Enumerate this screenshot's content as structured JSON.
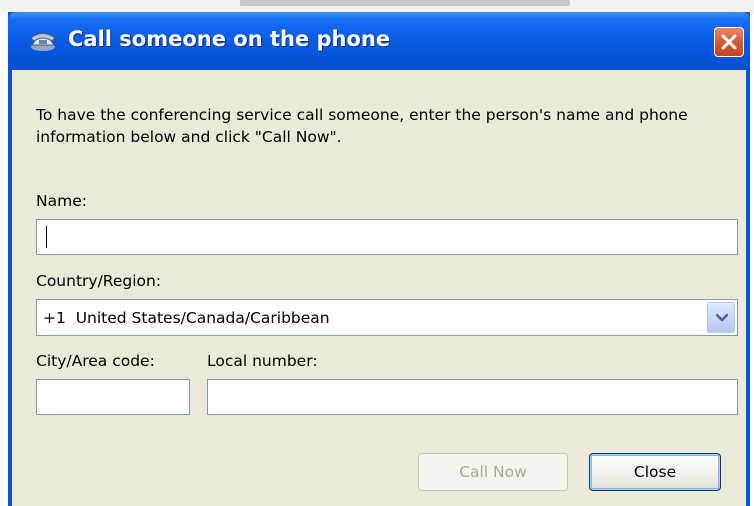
{
  "dialog": {
    "title": "Call someone on the phone",
    "close_icon": "close-icon",
    "title_icon": "phone-icon"
  },
  "instructions": "To have the conferencing service call someone, enter the person's name and phone information below and click \"Call Now\".",
  "fields": {
    "name_label": "Name:",
    "name_value": "",
    "country_label": "Country/Region:",
    "country_value": "+1  United States/Canada/Caribbean",
    "country_dropdown_icon": "chevron-down-icon",
    "area_code_label": "City/Area code:",
    "area_code_value": "",
    "local_number_label": "Local number:",
    "local_number_value": ""
  },
  "buttons": {
    "call_now": "Call Now",
    "close": "Close"
  },
  "colors": {
    "titlebar": "#0a55e0",
    "client_bg": "#ece9d8",
    "close_button": "#d65a36",
    "field_border": "#7f9db9"
  }
}
